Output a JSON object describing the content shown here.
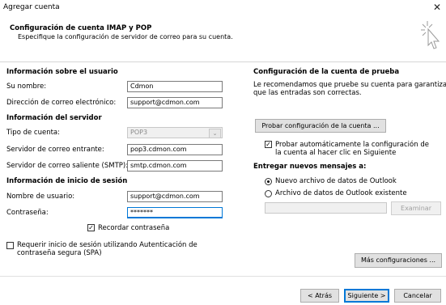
{
  "window": {
    "title": "Agregar cuenta",
    "close_glyph": "✕"
  },
  "header": {
    "title": "Configuración de cuenta IMAP y POP",
    "subtitle": "Especifique la configuración de servidor de correo para su cuenta."
  },
  "user_info": {
    "heading": "Información sobre el usuario",
    "name_label": "Su nombre:",
    "name_value": "Cdmon",
    "email_label": "Dirección de correo electrónico:",
    "email_value": "support@cdmon.com"
  },
  "server_info": {
    "heading": "Información del servidor",
    "account_type_label": "Tipo de cuenta:",
    "account_type_value": "POP3",
    "incoming_label": "Servidor de correo entrante:",
    "incoming_value": "pop3.cdmon.com",
    "outgoing_label": "Servidor de correo saliente (SMTP):",
    "outgoing_value": "smtp.cdmon.com"
  },
  "login_info": {
    "heading": "Información de inicio de sesión",
    "username_label": "Nombre de usuario:",
    "username_value": "support@cdmon.com",
    "password_label": "Contraseña:",
    "password_value": "*******",
    "remember_label": "Recordar contraseña",
    "remember_checked": true,
    "spa_label_line1": "Requerir inicio de sesión utilizando Autenticación de",
    "spa_label_line2": "contraseña segura (SPA)",
    "spa_checked": false
  },
  "test": {
    "heading": "Configuración de la cuenta de prueba",
    "desc_line1": "Le recomendamos que pruebe su cuenta para garantizar",
    "desc_line2": "que las entradas son correctas.",
    "test_button": "Probar configuración de la cuenta ...",
    "auto_test_line1": "Probar automáticamente la configuración de",
    "auto_test_line2": "la cuenta al hacer clic en Siguiente",
    "auto_test_checked": true
  },
  "deliver": {
    "heading": "Entregar nuevos mensajes a:",
    "option_new": "Nuevo archivo de datos de Outlook",
    "option_existing": "Archivo de datos de Outlook existente",
    "selected": "new",
    "browse_button": "Examinar"
  },
  "buttons": {
    "more_settings": "Más configuraciones ...",
    "back": "< Atrás",
    "next": "Siguiente >",
    "cancel": "Cancelar"
  },
  "icons": {
    "header_icon": "cursor-sparkle-icon"
  }
}
